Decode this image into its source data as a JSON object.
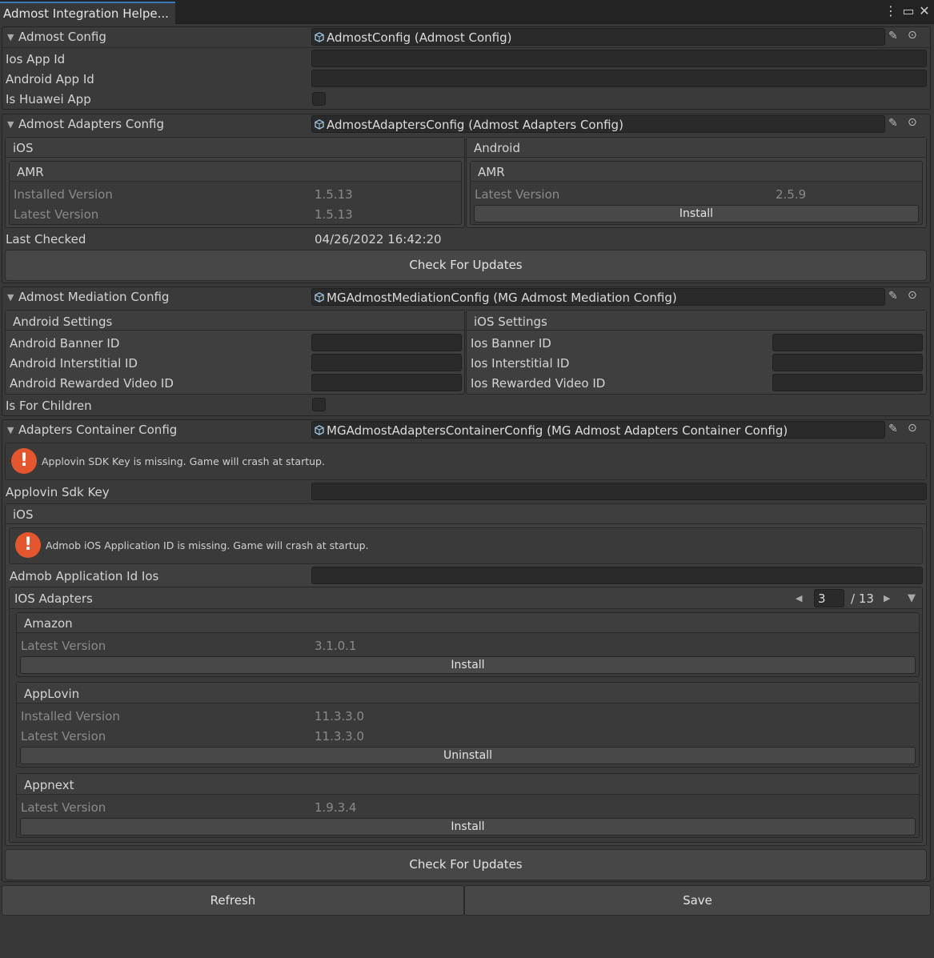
{
  "window": {
    "tab_title": "Admost Integration Helpe...",
    "menu_icon": "more-vert-icon",
    "max_icon": "maximize-icon",
    "close_icon": "close-icon"
  },
  "admost_config": {
    "title": "Admost Config",
    "object": "AdmostConfig (Admost Config)",
    "ios_app_id_label": "Ios App Id",
    "ios_app_id_value": "",
    "android_app_id_label": "Android App Id",
    "android_app_id_value": "",
    "is_huawei_label": "Is Huawei App"
  },
  "adapters_config": {
    "title": "Admost Adapters Config",
    "object": "AdmostAdaptersConfig (Admost Adapters Config)",
    "ios": {
      "title": "iOS",
      "adapter": "AMR",
      "installed_label": "Installed Version",
      "installed_value": "1.5.13",
      "latest_label": "Latest Version",
      "latest_value": "1.5.13"
    },
    "android": {
      "title": "Android",
      "adapter": "AMR",
      "latest_label": "Latest Version",
      "latest_value": "2.5.9",
      "install_label": "Install"
    },
    "last_checked_label": "Last Checked",
    "last_checked_value": "04/26/2022 16:42:20",
    "check_updates_label": "Check For Updates"
  },
  "mediation_config": {
    "title": "Admost Mediation Config",
    "object": "MGAdmostMediationConfig (MG Admost Mediation Config)",
    "android": {
      "title": "Android Settings",
      "banner_label": "Android Banner ID",
      "interstitial_label": "Android Interstitial ID",
      "rewarded_label": "Android Rewarded Video ID"
    },
    "ios": {
      "title": "iOS Settings",
      "banner_label": "Ios Banner ID",
      "interstitial_label": "Ios Interstitial ID",
      "rewarded_label": "Ios Rewarded Video ID"
    },
    "is_for_children_label": "Is For Children"
  },
  "container_config": {
    "title": "Adapters Container Config",
    "object": "MGAdmostAdaptersContainerConfig (MG Admost Adapters Container Config)",
    "warning_applovin": "Applovin SDK Key is missing. Game will crash at startup.",
    "applovin_key_label": "Applovin Sdk Key",
    "ios": {
      "title": "iOS",
      "warning_admob": "Admob iOS Application ID is missing. Game will crash at startup.",
      "admob_id_label": "Admob Application Id Ios",
      "adapters_title": "IOS Adapters",
      "page_value": "3",
      "page_total": "/ 13",
      "adapters": [
        {
          "name": "Amazon",
          "latest_label": "Latest Version",
          "latest_value": "3.1.0.1",
          "action": "Install"
        },
        {
          "name": "AppLovin",
          "installed_label": "Installed Version",
          "installed_value": "11.3.3.0",
          "latest_label": "Latest Version",
          "latest_value": "11.3.3.0",
          "action": "Uninstall"
        },
        {
          "name": "Appnext",
          "latest_label": "Latest Version",
          "latest_value": "1.9.3.4",
          "action": "Install"
        }
      ]
    },
    "check_updates_label": "Check For Updates"
  },
  "footer": {
    "refresh_label": "Refresh",
    "save_label": "Save"
  }
}
